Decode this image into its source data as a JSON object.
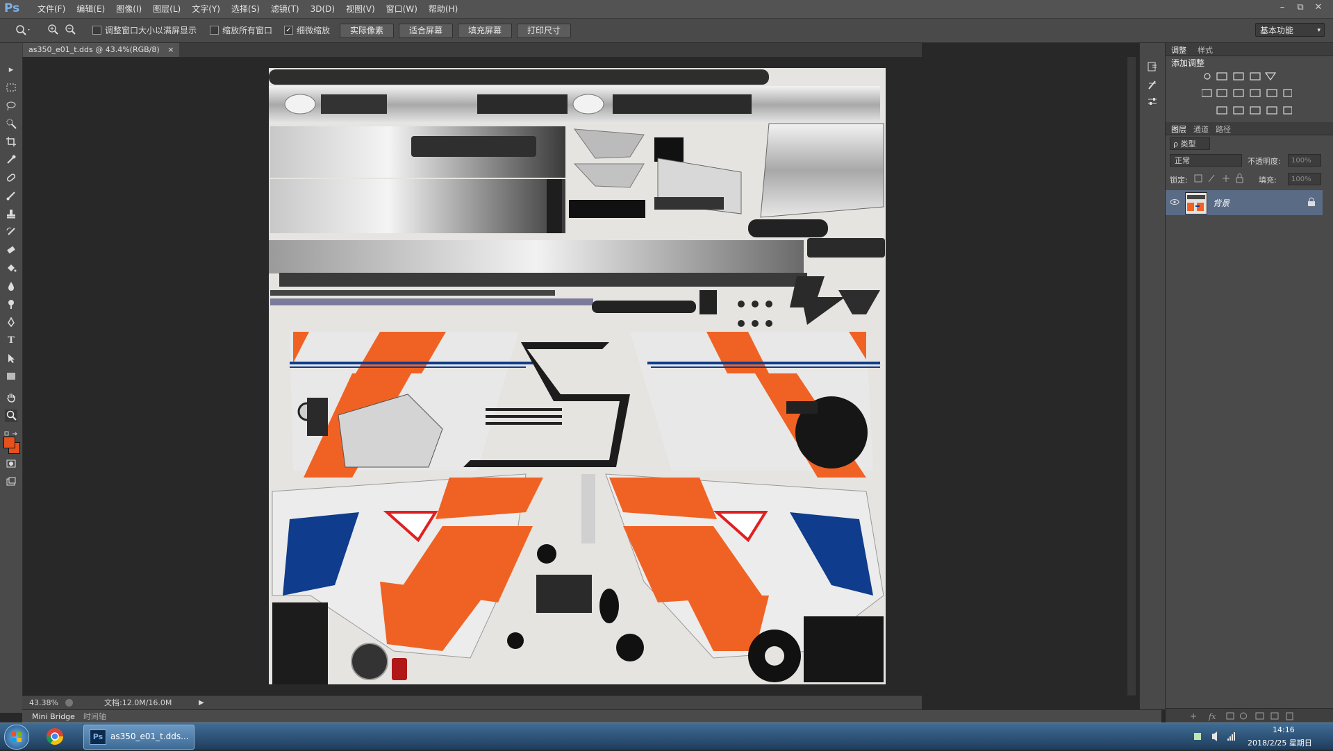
{
  "app": {
    "logo": "Ps"
  },
  "menu": [
    "文件(F)",
    "编辑(E)",
    "图像(I)",
    "图层(L)",
    "文字(Y)",
    "选择(S)",
    "滤镜(T)",
    "3D(D)",
    "视图(V)",
    "窗口(W)",
    "帮助(H)"
  ],
  "window_controls": [
    "–",
    "⧉",
    "✕"
  ],
  "options": {
    "resize_windows": {
      "label": "调整窗口大小以满屏显示",
      "checked": false
    },
    "zoom_all": {
      "label": "缩放所有窗口",
      "checked": false
    },
    "scrubby_zoom": {
      "label": "细微缩放",
      "checked": true
    },
    "buttons": [
      "实际像素",
      "适合屏幕",
      "填充屏幕",
      "打印尺寸"
    ],
    "workspace": "基本功能"
  },
  "document": {
    "tab_label": "as350_e01_t.dds @ 43.4%(RGB/8)",
    "close": "×"
  },
  "status": {
    "zoom": "43.38%",
    "doc_size": "文档:12.0M/16.0M"
  },
  "bottom_tabs": [
    "Mini Bridge",
    "时间轴"
  ],
  "colors": {
    "foreground": "#e8501c",
    "background": "#e8501c",
    "accent_orange": "#f06224",
    "accent_blue": "#0f3c8c"
  },
  "adjustments_panel": {
    "tabs": [
      "调整",
      "样式"
    ],
    "title": "添加调整"
  },
  "layers_panel": {
    "tabs": [
      "图层",
      "通道",
      "路径"
    ],
    "filter_label": "ρ 类型",
    "blend_mode": "正常",
    "opacity_label": "不透明度:",
    "opacity_value": "100%",
    "lock_label": "锁定:",
    "fill_label": "填充:",
    "fill_value": "100%",
    "layers": [
      {
        "name": "背景",
        "visible": true,
        "locked": true
      }
    ]
  },
  "taskbar": {
    "task_label": "as350_e01_t.dds...",
    "time": "14:16",
    "date": "2018/2/25 星期日"
  }
}
